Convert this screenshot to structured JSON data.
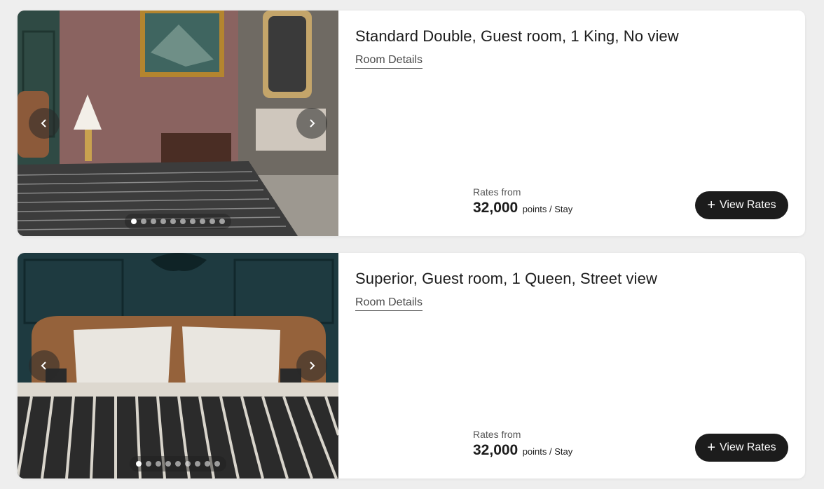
{
  "rooms": [
    {
      "title": "Standard Double, Guest room, 1 King, No view",
      "details_link": "Room Details",
      "rates_label": "Rates from",
      "rates_amount": "32,000",
      "rates_unit": "points / Stay",
      "view_rates_plus": "+",
      "view_rates_label": "View Rates",
      "photo_count": 10,
      "active_photo": 1
    },
    {
      "title": "Superior, Guest room, 1 Queen, Street view",
      "details_link": "Room Details",
      "rates_label": "Rates from",
      "rates_amount": "32,000",
      "rates_unit": "points / Stay",
      "view_rates_plus": "+",
      "view_rates_label": "View Rates",
      "photo_count": 9,
      "active_photo": 1
    }
  ],
  "icons": {
    "prev": "chevron-left-icon",
    "next": "chevron-right-icon"
  },
  "colors": {
    "button_bg": "#1c1c1c",
    "page_bg": "#eeeeee",
    "card_bg": "#ffffff"
  }
}
